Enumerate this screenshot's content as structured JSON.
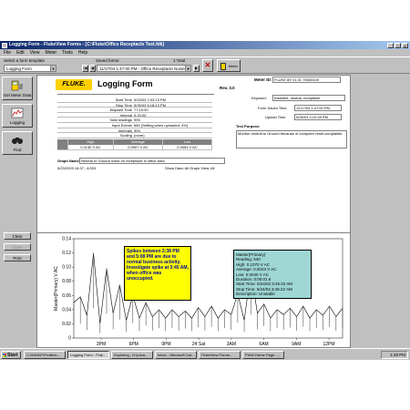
{
  "window": {
    "title": "Logging Form - FlukeView Forms - [C:\\Fluke\\Office Receptacle Test.fdk]"
  },
  "menu": [
    "File",
    "Edit",
    "View",
    "Meter",
    "Tools",
    "Help"
  ],
  "toolbar": {
    "template_label": "Select a form template",
    "template_value": "Logging Form",
    "saved_forms_label": "Saved forms:",
    "total": "1 Total",
    "saved_form_value": "11/17/04 1:47:00 PM - Office Receptacle Noise",
    "meter_label": "Meter"
  },
  "sidebar": {
    "buttons": [
      {
        "label": "Get Meter Data",
        "icon": "meter-icon"
      },
      {
        "label": "Logging",
        "icon": "logging-icon"
      },
      {
        "label": "Find",
        "icon": "binoculars-icon"
      }
    ],
    "small_buttons": [
      "Clear",
      "Close",
      "Print"
    ]
  },
  "form": {
    "logo": "FLUKE.",
    "title": "Logging Form",
    "rev": "Rev. 3.0",
    "meter_id_label": "Meter ID:",
    "meter_id": "FLUKE 89 V1.01 75500449",
    "info": [
      {
        "k": "Start Time",
        "v": "5/23/03 1:03:13 PM"
      },
      {
        "k": "Stop Time",
        "v": "5/26/03 6:18:13 PM"
      },
      {
        "k": "Elapsed Time",
        "v": "77:15:00"
      },
      {
        "k": "Interval",
        "v": "0:15:00"
      },
      {
        "k": "Total readings",
        "v": "995"
      },
      {
        "k": "Input Events",
        "v": "680   (Setting when uploaded: 4%)"
      },
      {
        "k": "Intervals",
        "v": "309"
      },
      {
        "k": "Scaling",
        "v": "(none)"
      }
    ],
    "measure_headers": [
      "High",
      "Average",
      "Low"
    ],
    "measure_values": [
      "0.1130 V AC",
      "0.0007 V AC",
      "0.0054 V AC"
    ],
    "keyword_label": "Keyword:",
    "keyword_value": "transient, neutral, receptacle",
    "form_saved_label": "Form Saved Time",
    "form_saved_value": "11/17/04 1:47:00 PM",
    "upload_label": "Upload Time",
    "upload_value": "5/26/03 2:10:39 PM",
    "test_purpose_label": "Test Purpose:",
    "test_purpose": "Monitor neutral to Ground because of computer reset complaints.",
    "graph_name_label": "Graph Name:",
    "graph_name": "Neutral to Ground noise on receptacle in office area",
    "show_data": "Show Data: All   Graph View: All",
    "cursor_time": "5/23/2003  16:37...4/203"
  },
  "chart_data": {
    "type": "line",
    "ylabel": "Master(Primary)   V AC",
    "ylim": [
      0,
      0.14
    ],
    "yticks": [
      "0",
      "0.02",
      "0.04",
      "0.06",
      "0.08",
      "0.10",
      "0.12",
      "0.14"
    ],
    "xticks": [
      "3PM",
      "6PM",
      "9PM",
      "24 Sat",
      "3AM",
      "6AM",
      "9AM",
      "12PM"
    ],
    "series": [
      {
        "values": [
          0.05,
          0.058,
          0.032,
          0.12,
          0.02,
          0.098,
          0.035,
          0.075,
          0.025,
          0.06,
          0.028,
          0.05,
          0.03,
          0.04,
          0.028,
          0.04,
          0.03,
          0.038,
          0.028,
          0.043,
          0.03,
          0.045,
          0.028,
          0.04,
          0.033,
          0.062,
          0.025,
          0.095,
          0.035,
          0.048,
          0.028,
          0.04,
          0.033,
          0.042,
          0.03,
          0.045,
          0.028,
          0.04,
          0.032,
          0.045,
          0.03,
          0.042
        ]
      }
    ],
    "annotation_yellow": "Spikes between 2:38 PM and 5:08 PM are due to normal business activity. Investigate spike at 3:45 AM, when office was unoccupied.",
    "annotation_cyan": [
      "Master(Primary)",
      "Reading:  540",
      "High:  0.1070 V AC",
      "Average:  0.0023 V AC",
      "Low:  0.0040 V AC",
      "Duration:  0:00:01.6",
      "Start Time:  5/24/03 3:45:22 AM",
      "Stop Time:  5/24/03 3:45:22 AM",
      "Description:  Unstable"
    ]
  },
  "taskbar": {
    "start": "Start",
    "tasks": [
      "C:\\WINNT\\Profiles\\...",
      "Logging Form - Fluk...",
      "Exploring - H:\\priva...",
      "Inbox - Microsoft Out...",
      "FlukeView Forms...",
      "FWW Home Page -..."
    ],
    "clock": "1:49 PM"
  }
}
